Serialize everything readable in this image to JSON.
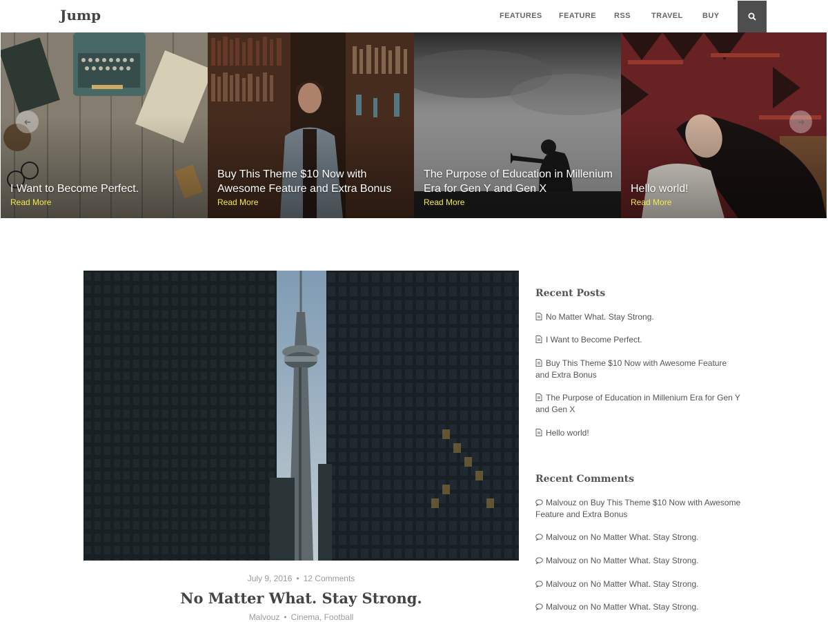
{
  "site": {
    "logo": "Jump"
  },
  "nav": {
    "items": [
      "FEATURES",
      "FEATURE",
      "RSS",
      "TRAVEL",
      "BUY"
    ],
    "search_icon": "search-icon"
  },
  "slider": {
    "read_more": "Read More",
    "slides": [
      {
        "title": "I Want to Become Perfect."
      },
      {
        "title": "Buy This Theme $10 Now with Awesome Feature and Extra Bonus"
      },
      {
        "title": "The Purpose of Education in Millenium Era for Gen Y and Gen X"
      },
      {
        "title": "Hello world!"
      }
    ],
    "read_more_color": "#f5e94a"
  },
  "post": {
    "date": "July 9, 2016",
    "comments": "12 Comments",
    "title": "No Matter What. Stay Strong.",
    "author": "Malvouz",
    "categories": "Cinema, Football"
  },
  "sidebar": {
    "recent_posts_title": "Recent Posts",
    "recent_posts": [
      "No Matter What. Stay Strong.",
      "I Want to Become Perfect.",
      "Buy This Theme $10 Now with Awesome Feature and Extra Bonus",
      "The Purpose of Education in Millenium Era for Gen Y and Gen X",
      "Hello world!"
    ],
    "recent_comments_title": "Recent Comments",
    "recent_comments": [
      {
        "author": "Malvouz",
        "on": "on",
        "post": "Buy This Theme $10 Now with Awesome Feature and Extra Bonus"
      },
      {
        "author": "Malvouz",
        "on": "on",
        "post": "No Matter What. Stay Strong."
      },
      {
        "author": "Malvouz",
        "on": "on",
        "post": "No Matter What. Stay Strong."
      },
      {
        "author": "Malvouz",
        "on": "on",
        "post": "No Matter What. Stay Strong."
      },
      {
        "author": "Malvouz",
        "on": "on",
        "post": "No Matter What. Stay Strong."
      }
    ]
  }
}
